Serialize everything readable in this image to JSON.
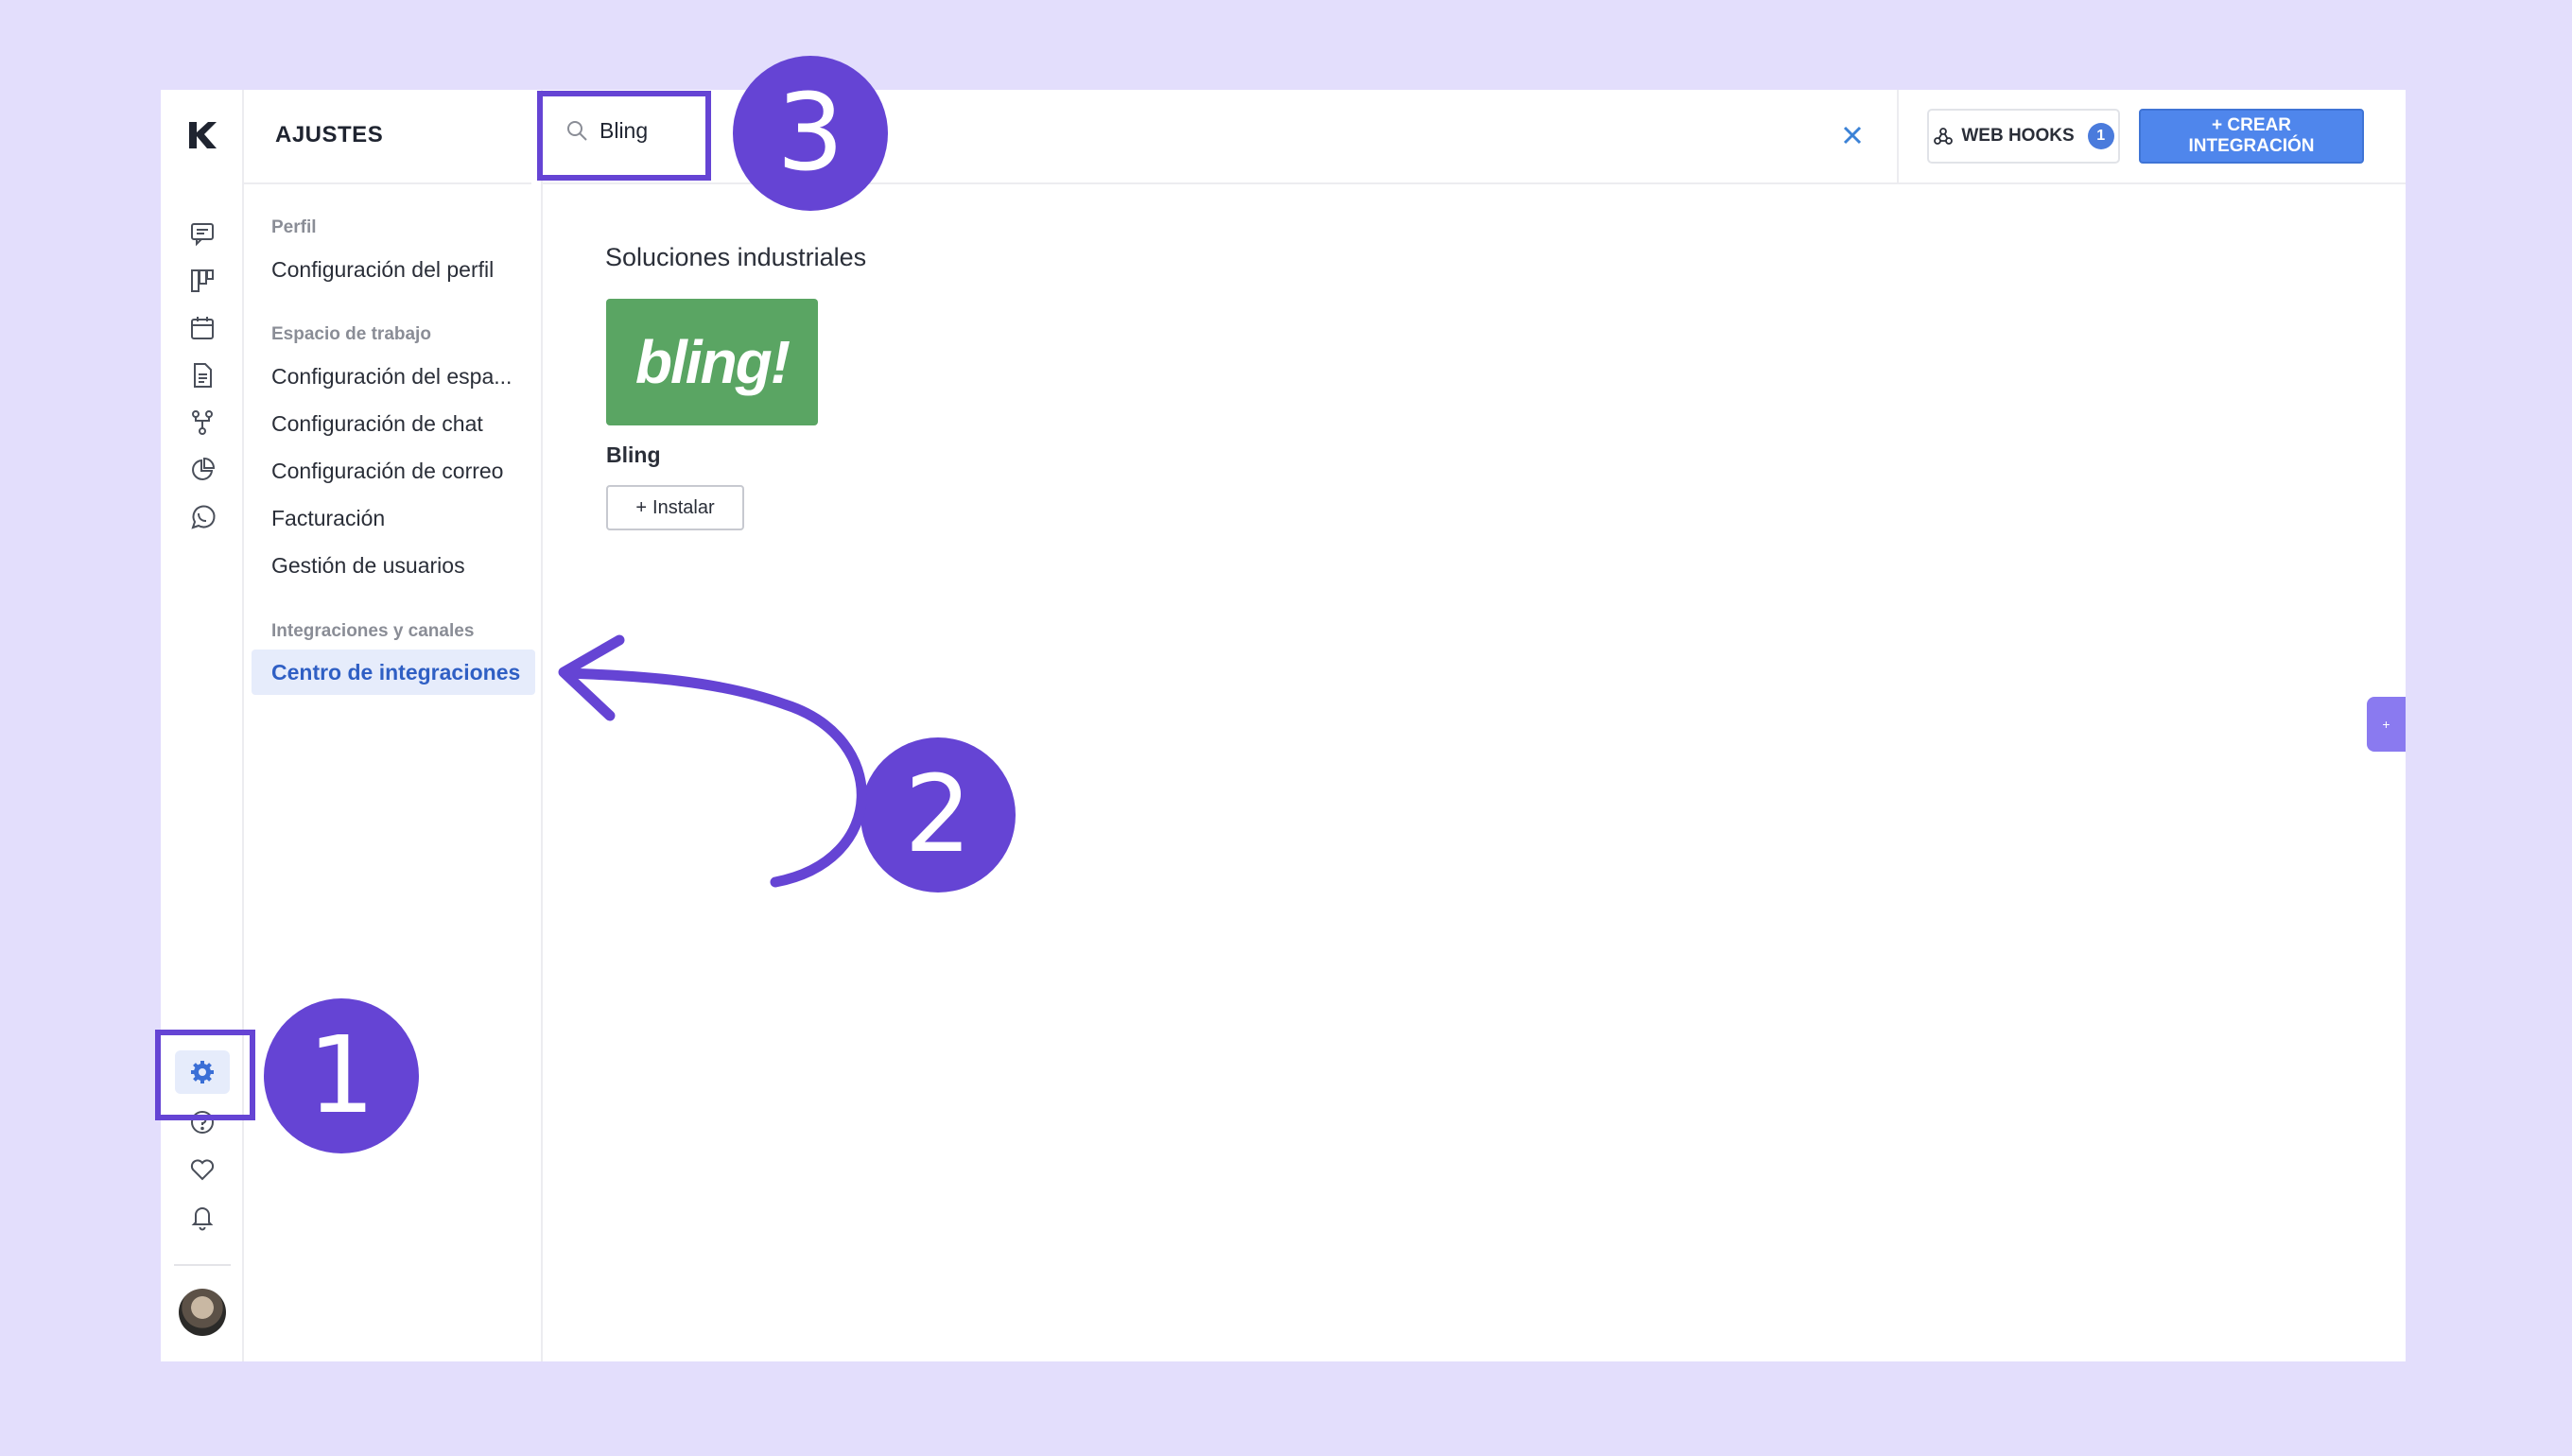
{
  "colors": {
    "background": "#e3defc",
    "accent": "#6544d4",
    "primary": "#4f86ec",
    "active_nav": "#2f5fc4",
    "bling_green": "#5aa563"
  },
  "nav": {
    "title": "AJUSTES",
    "sections": [
      {
        "label": "Perfil",
        "items": [
          "Configuración del perfil"
        ]
      },
      {
        "label": "Espacio de trabajo",
        "items": [
          "Configuración del espa...",
          "Configuración de chat",
          "Configuración de correo",
          "Facturación",
          "Gestión de usuarios"
        ]
      },
      {
        "label": "Integraciones y canales",
        "items": [
          "Centro de integraciones"
        ]
      }
    ]
  },
  "rail": {
    "icons": [
      "chat-icon",
      "kanban-icon",
      "calendar-icon",
      "document-icon",
      "flow-icon",
      "pie-chart-icon",
      "whatsapp-icon"
    ],
    "bottom_icons": [
      "settings-icon",
      "help-icon",
      "heart-icon",
      "bell-icon"
    ]
  },
  "search": {
    "value": "Bling",
    "placeholder": ""
  },
  "toolbar": {
    "webhooks_label": "WEB HOOKS",
    "webhooks_count": "1",
    "create_label": "+ CREAR INTEGRACIÓN"
  },
  "content": {
    "section_title": "Soluciones industriales",
    "card": {
      "logo_text": "bling!",
      "name": "Bling",
      "install_label": "Instalar",
      "install_icon": "+"
    }
  },
  "side_tab": {
    "icon": "+"
  },
  "steps": {
    "one": "1",
    "two": "2",
    "three": "3"
  }
}
